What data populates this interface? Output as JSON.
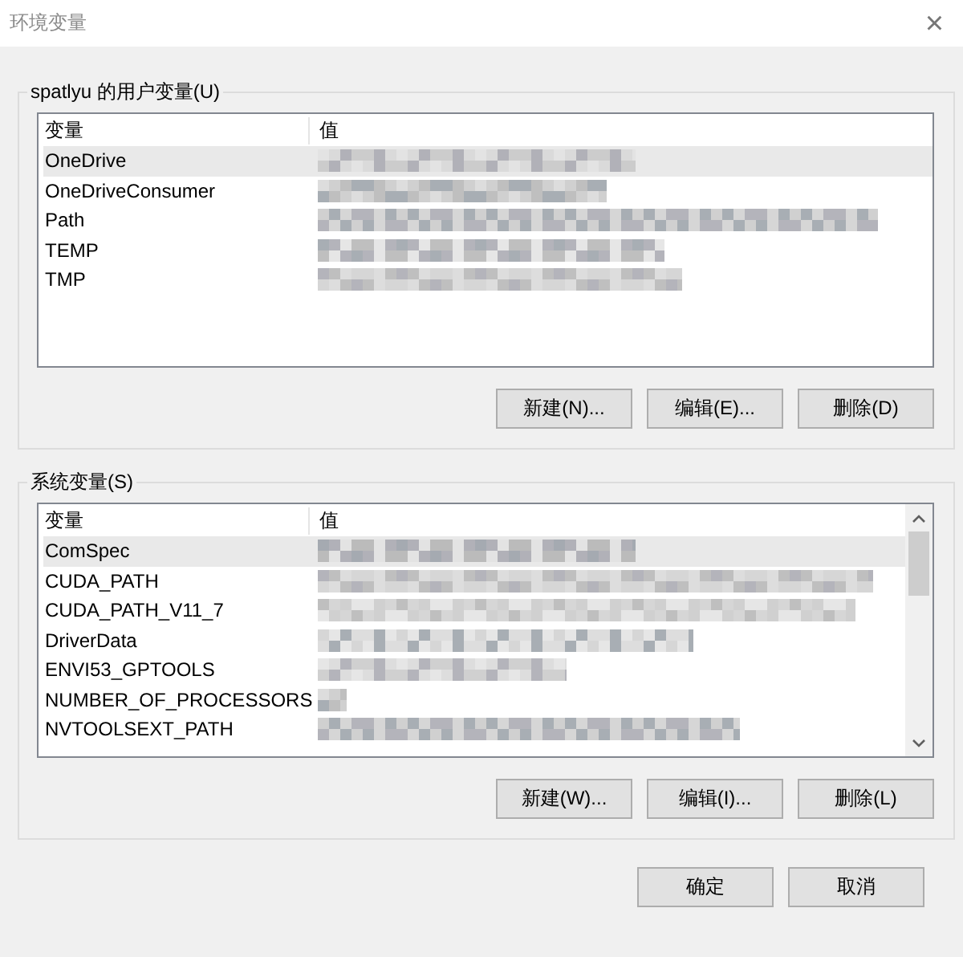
{
  "window": {
    "title": "环境变量",
    "close": "×"
  },
  "groups": [
    {
      "legend": "spatlyu 的用户变量(U)",
      "columns": [
        "变量",
        "值"
      ],
      "scrollbar": false,
      "rows": [
        {
          "name": "OneDrive",
          "redacted": true,
          "selected": true
        },
        {
          "name": "OneDriveConsumer",
          "redacted": true,
          "selected": false
        },
        {
          "name": "Path",
          "redacted": true,
          "selected": false
        },
        {
          "name": "TEMP",
          "redacted": true,
          "selected": false
        },
        {
          "name": "TMP",
          "redacted": true,
          "selected": false
        }
      ],
      "buttons": [
        "新建(N)...",
        "编辑(E)...",
        "删除(D)"
      ]
    },
    {
      "legend": "系统变量(S)",
      "columns": [
        "变量",
        "值"
      ],
      "scrollbar": true,
      "rows": [
        {
          "name": "ComSpec",
          "redacted": true,
          "selected": true
        },
        {
          "name": "CUDA_PATH",
          "redacted": true,
          "selected": false
        },
        {
          "name": "CUDA_PATH_V11_7",
          "redacted": true,
          "selected": false
        },
        {
          "name": "DriverData",
          "redacted": true,
          "selected": false
        },
        {
          "name": "ENVI53_GPTOOLS",
          "redacted": true,
          "selected": false
        },
        {
          "name": "NUMBER_OF_PROCESSORS",
          "redacted": true,
          "selected": false
        },
        {
          "name": "NVTOOLSEXT_PATH",
          "redacted": true,
          "selected": false
        }
      ],
      "buttons": [
        "新建(W)...",
        "编辑(I)...",
        "删除(L)"
      ]
    }
  ],
  "footer_buttons": [
    "确定",
    "取消"
  ]
}
